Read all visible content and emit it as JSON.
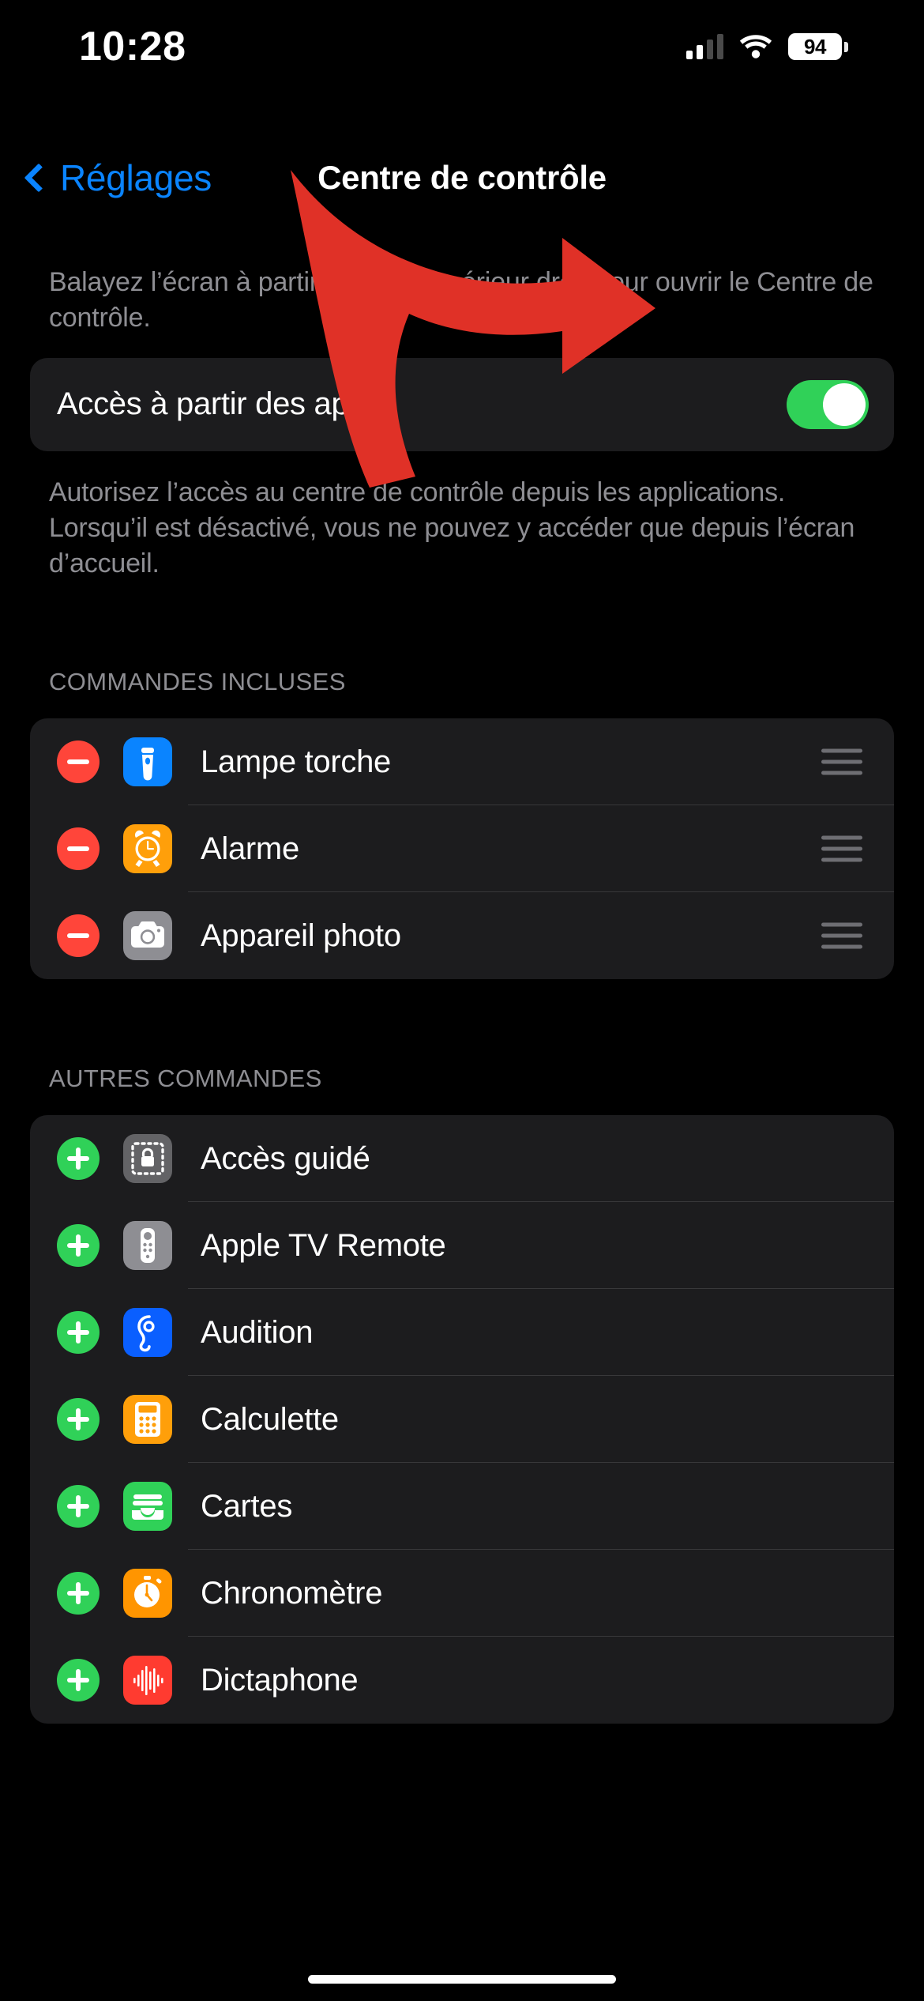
{
  "statusbar": {
    "time": "10:28",
    "battery_level": "94",
    "cellular_icon": "cellular-bars-icon",
    "wifi_icon": "wifi-icon",
    "battery_icon": "battery-icon"
  },
  "navbar": {
    "back_label": "Réglages",
    "back_icon": "chevron-left-icon",
    "title": "Centre de contrôle"
  },
  "intro": {
    "text": "Balayez l’écran à partir du coin supérieur droit pour ouvrir le Centre de contrôle."
  },
  "access_toggle": {
    "label": "Accès à partir des apps",
    "state": "on",
    "footer": "Autorisez l’accès au centre de contrôle depuis les applications. Lorsqu’il est désactivé, vous ne pouvez y accéder que depuis l’écran d’accueil."
  },
  "included": {
    "header": "COMMANDES INCLUSES",
    "items": [
      {
        "label": "Lampe torche",
        "action": "remove",
        "icon": "flashlight-icon",
        "icon_color": "#0A84FF",
        "handle_icon": "reorder-handle-icon"
      },
      {
        "label": "Alarme",
        "action": "remove",
        "icon": "alarm-clock-icon",
        "icon_color": "#FF9F0A",
        "handle_icon": "reorder-handle-icon"
      },
      {
        "label": "Appareil photo",
        "action": "remove",
        "icon": "camera-icon",
        "icon_color": "#8E8E93",
        "handle_icon": "reorder-handle-icon"
      }
    ]
  },
  "more": {
    "header": "AUTRES COMMANDES",
    "items": [
      {
        "label": "Accès guidé",
        "action": "add",
        "icon": "guided-access-lock-icon",
        "icon_color": "#636366"
      },
      {
        "label": "Apple TV Remote",
        "action": "add",
        "icon": "tv-remote-icon",
        "icon_color": "#8E8E93"
      },
      {
        "label": "Audition",
        "action": "add",
        "icon": "ear-hearing-icon",
        "icon_color": "#0A5FFF"
      },
      {
        "label": "Calculette",
        "action": "add",
        "icon": "calculator-icon",
        "icon_color": "#FF9F0A"
      },
      {
        "label": "Cartes",
        "action": "add",
        "icon": "wallet-icon",
        "icon_color": "#30D158"
      },
      {
        "label": "Chronomètre",
        "action": "add",
        "icon": "stopwatch-icon",
        "icon_color": "#FF9500"
      },
      {
        "label": "Dictaphone",
        "action": "add",
        "icon": "voice-memos-icon",
        "icon_color": "#FF3B30"
      }
    ]
  },
  "annotation": {
    "arrow_icon": "red-curved-arrow-icon",
    "color": "#E03127",
    "points_to": "Accès à partir des apps toggle"
  },
  "colors": {
    "background": "#000000",
    "card": "#1C1C1E",
    "accent_blue": "#0A84FF",
    "green": "#30D158",
    "red": "#FF453A",
    "secondary_text": "#8E8E93",
    "separator": "#38383A"
  }
}
